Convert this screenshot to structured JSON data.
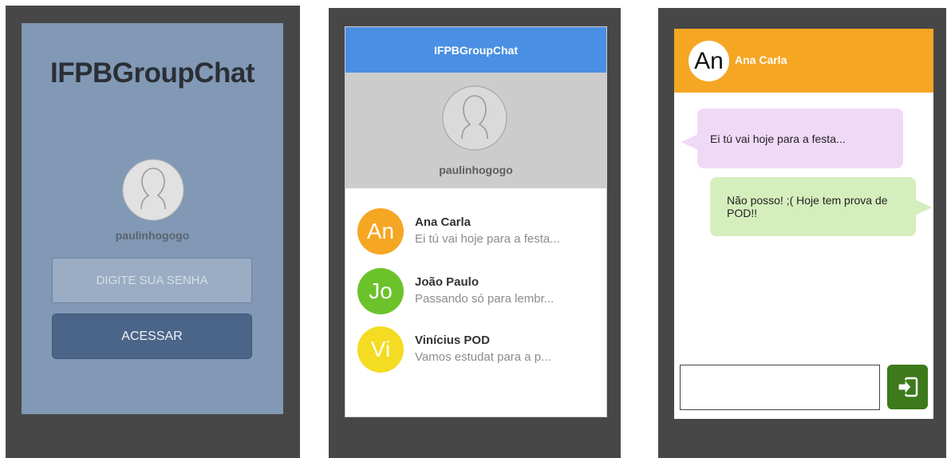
{
  "login": {
    "app_title": "IFPBGroupChat",
    "username": "paulinhogogo",
    "password_placeholder": "DIGITE SUA SENHA",
    "submit_label": "ACESSAR"
  },
  "contacts": {
    "header_title": "IFPBGroupChat",
    "username": "paulinhogogo",
    "items": [
      {
        "initials": "An",
        "name": "Ana Carla",
        "preview": "Ei tú vai hoje para a festa...",
        "color": "#f5a623"
      },
      {
        "initials": "Jo",
        "name": "João Paulo",
        "preview": "Passando só para lembr...",
        "color": "#6cc22b"
      },
      {
        "initials": "Vi",
        "name": "Vinícius POD",
        "preview": "Vamos estudat para a p...",
        "color": "#f3dc21"
      }
    ]
  },
  "chat": {
    "contact_initials": "An",
    "contact_name": "Ana Carla",
    "header_color": "#f5a623",
    "messages": [
      {
        "direction": "incoming",
        "text": "Ei tú vai hoje para a festa..."
      },
      {
        "direction": "outgoing",
        "text": "Não posso! ;( Hoje tem prova de POD!!"
      }
    ],
    "input_value": "",
    "send_icon": "send-icon"
  }
}
